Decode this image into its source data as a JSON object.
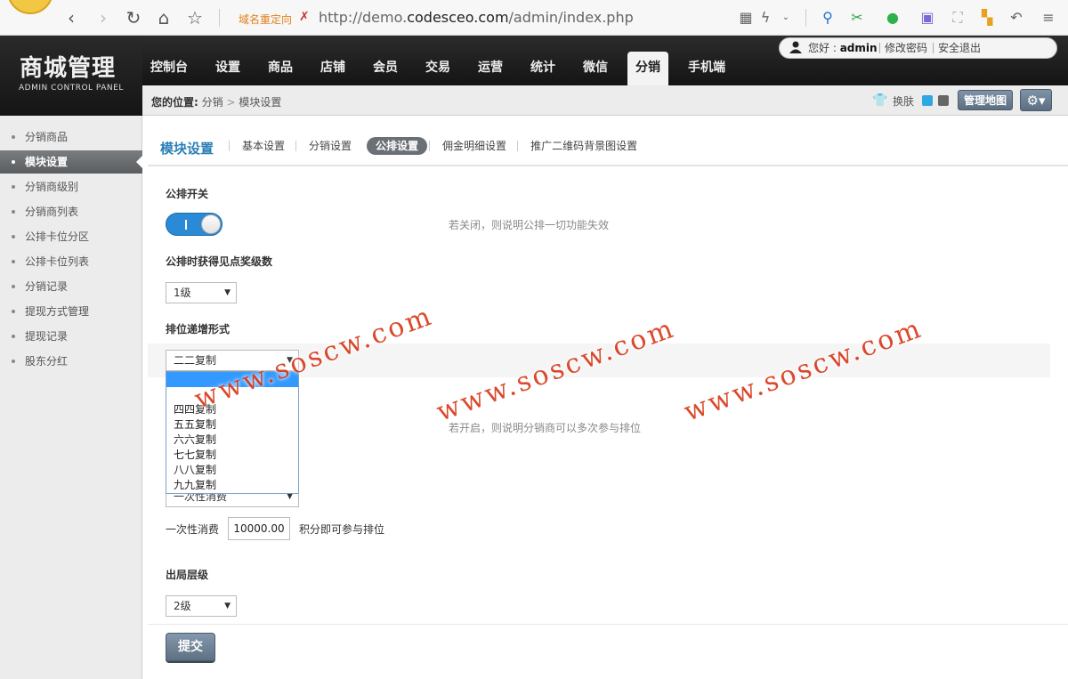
{
  "browser": {
    "redirect_label": "域名重定向",
    "url_prefix": "http://demo.",
    "url_domain": "codesceo.com",
    "url_path": "/admin/index.php"
  },
  "brand": {
    "title": "商城管理",
    "subtitle": "ADMIN CONTROL PANEL"
  },
  "main_nav": [
    "控制台",
    "设置",
    "商品",
    "店铺",
    "会员",
    "交易",
    "运营",
    "统计",
    "微信",
    "分销",
    "手机端"
  ],
  "user": {
    "greeting_prefix": "您好 : ",
    "username": "admin",
    "change_password": "修改密码",
    "logout": "安全退出"
  },
  "breadcrumb": {
    "label": "您的位置:",
    "level1": "分销",
    "sep": ">",
    "level2": "模块设置"
  },
  "toolbar": {
    "skin_label": "换肤",
    "map_button": "管理地图"
  },
  "sidebar": [
    "分销商品",
    "模块设置",
    "分销商级别",
    "分销商列表",
    "公排卡位分区",
    "公排卡位列表",
    "分销记录",
    "提现方式管理",
    "提现记录",
    "股东分红"
  ],
  "page_title": "模块设置",
  "tabs": [
    "基本设置",
    "分销设置",
    "公排设置",
    "佣金明细设置",
    "推广二维码背景图设置"
  ],
  "form": {
    "switch_label": "公排开关",
    "switch_hint": "若关闭，则说明公排一切功能失效",
    "reward_label": "公排时获得见点奖级数",
    "reward_value": "1级",
    "rank_label": "排位递增形式",
    "rank_value": "二二复制",
    "rank_options": [
      "四四复制",
      "五五复制",
      "六六复制",
      "七七复制",
      "八八复制",
      "九九复制"
    ],
    "multi_hint": "若开启，则说明分销商可以多次参与排位",
    "consume_select": "一次性消费",
    "consume_label": "一次性消费",
    "consume_value": "10000.00",
    "consume_suffix": "积分即可参与排位",
    "exit_label": "出局层级",
    "exit_value": "2级",
    "submit": "提交"
  },
  "watermark": "www.soscw.com"
}
